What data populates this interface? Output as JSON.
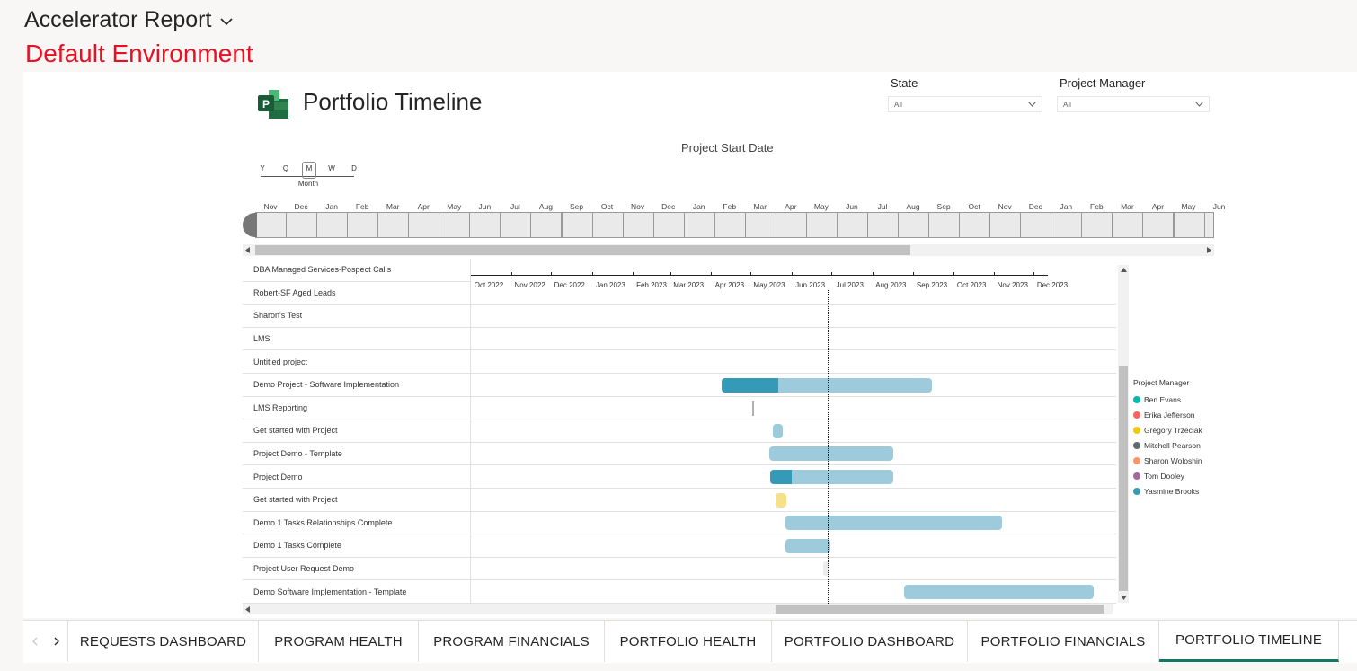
{
  "header": {
    "app_title": "Accelerator Report",
    "environment": "Default Environment"
  },
  "report": {
    "title": "Portfolio Timeline",
    "axis_title": "Project Start Date",
    "slicers": [
      {
        "label": "State",
        "value": "All"
      },
      {
        "label": "Project Manager",
        "value": "All"
      }
    ],
    "levels": {
      "items": [
        "Y",
        "Q",
        "M",
        "W",
        "D"
      ],
      "selected": "M",
      "selected_label": "Month"
    },
    "timeline_months": [
      "Nov",
      "Dec",
      "Jan",
      "Feb",
      "Mar",
      "Apr",
      "May",
      "Jun",
      "Jul",
      "Aug",
      "Sep",
      "Oct",
      "Nov",
      "Dec",
      "Jan",
      "Feb",
      "Mar",
      "Apr",
      "May",
      "Jun",
      "Jul",
      "Aug",
      "Sep",
      "Oct",
      "Nov",
      "Dec",
      "Jan",
      "Feb",
      "Mar",
      "Apr",
      "May",
      "Jun"
    ],
    "gantt_months": [
      "Oct 2022",
      "Nov 2022",
      "Dec 2022",
      "Jan 2023",
      "Feb 2023",
      "Mar 2023",
      "Apr 2023",
      "May 2023",
      "Jun 2023",
      "Jul 2023",
      "Aug 2023",
      "Sep 2023",
      "Oct 2023",
      "Nov 2023",
      "Dec 2023"
    ],
    "projects": [
      {
        "name": "DBA Managed Services-Pospect Calls"
      },
      {
        "name": "Robert-SF Aged Leads"
      },
      {
        "name": "Sharon's Test"
      },
      {
        "name": "LMS"
      },
      {
        "name": "Untitled project"
      },
      {
        "name": "Demo Project - Software Implementation",
        "start": "2023-04-09",
        "end": "2023-09-15",
        "progress": 0.27,
        "manager": "Yasmine Brooks"
      },
      {
        "name": "LMS Reporting",
        "start": "2023-05-02",
        "end": "2023-05-02",
        "manager": "Mitchell Pearson",
        "milestone": true
      },
      {
        "name": "Get started with Project",
        "start": "2023-05-18",
        "end": "2023-05-25",
        "progress": 0,
        "manager": "Yasmine Brooks"
      },
      {
        "name": "Project Demo - Template",
        "start": "2023-05-15",
        "end": "2023-08-17",
        "progress": 0,
        "manager": "Yasmine Brooks"
      },
      {
        "name": "Project Demo",
        "start": "2023-05-16",
        "end": "2023-08-17",
        "progress": 0.17,
        "manager": "Yasmine Brooks"
      },
      {
        "name": "Get started with Project",
        "start": "2023-05-20",
        "end": "2023-05-28",
        "progress": 0,
        "manager": "Gregory Trzeciak"
      },
      {
        "name": "Demo 1 Tasks Relationships Complete",
        "start": "2023-05-27",
        "end": "2023-11-07",
        "progress": 0,
        "manager": "Yasmine Brooks"
      },
      {
        "name": "Demo 1 Tasks Complete",
        "start": "2023-05-27",
        "end": "2023-06-30",
        "progress": 0,
        "manager": "Yasmine Brooks"
      },
      {
        "name": "Project User Request Demo",
        "start": "2023-06-25",
        "end": "2023-06-28",
        "progress": 0,
        "manager": "Other"
      },
      {
        "name": "Demo Software Implementation - Template",
        "start": "2023-08-25",
        "end": "2024-01-15",
        "progress": 0,
        "manager": "Yasmine Brooks"
      }
    ],
    "today": "2023-06-28",
    "legend": {
      "title": "Project Manager",
      "items": [
        {
          "name": "Ben Evans",
          "color": "#01b8aa"
        },
        {
          "name": "Erika Jefferson",
          "color": "#fd625e"
        },
        {
          "name": "Gregory Trzeciak",
          "color": "#f2c80f"
        },
        {
          "name": "Mitchell Pearson",
          "color": "#5f6b6d"
        },
        {
          "name": "Sharon Woloshin",
          "color": "#fe9666"
        },
        {
          "name": "Tom Dooley",
          "color": "#a66999"
        },
        {
          "name": "Yasmine Brooks",
          "color": "#3599b8"
        }
      ]
    },
    "bar_colors": {
      "Yasmine Brooks": "#9dcbdb",
      "Yasmine Brooks_progress": "#3599b8",
      "Gregory Trzeciak": "#f7e08a",
      "Mitchell Pearson": "#b0b0b0",
      "Other": "#ececec"
    }
  },
  "tabs": [
    {
      "label": "REQUESTS DASHBOARD"
    },
    {
      "label": "PROGRAM HEALTH"
    },
    {
      "label": "PROGRAM FINANCIALS"
    },
    {
      "label": "PORTFOLIO HEALTH"
    },
    {
      "label": "PORTFOLIO DASHBOARD"
    },
    {
      "label": "PORTFOLIO FINANCIALS"
    },
    {
      "label": "PORTFOLIO TIMELINE",
      "active": true
    }
  ]
}
